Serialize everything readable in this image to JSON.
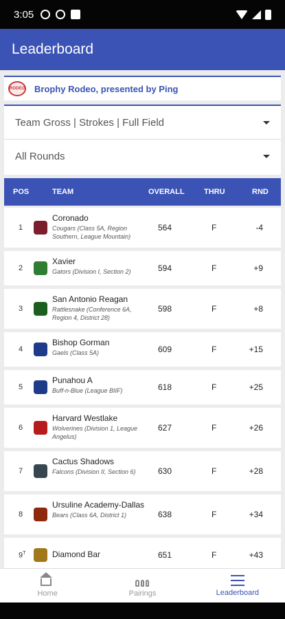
{
  "status": {
    "time": "3:05"
  },
  "appbar": {
    "title": "Leaderboard"
  },
  "tournament": {
    "name": "Brophy Rodeo, presented by Ping",
    "logo_text": "RODEO"
  },
  "filters": {
    "view": "Team Gross | Strokes | Full Field",
    "rounds": "All Rounds"
  },
  "table": {
    "headers": {
      "pos": "POS",
      "team": "TEAM",
      "overall": "OVERALL",
      "thru": "THRU",
      "rnd": "RND"
    },
    "rows": [
      {
        "pos": "1",
        "name": "Coronado",
        "sub": "Cougars (Class 5A, Region Southern, League Mountain)",
        "overall": "564",
        "thru": "F",
        "rnd": "-4",
        "color": "#7a1f2b"
      },
      {
        "pos": "2",
        "name": "Xavier",
        "sub": "Gators (Division I, Section 2)",
        "overall": "594",
        "thru": "F",
        "rnd": "+9",
        "color": "#2e7d32"
      },
      {
        "pos": "3",
        "name": "San Antonio Reagan",
        "sub": "Rattlesnake (Conference 6A, Region 4, District 28)",
        "overall": "598",
        "thru": "F",
        "rnd": "+8",
        "color": "#1b5e20"
      },
      {
        "pos": "4",
        "name": "Bishop Gorman",
        "sub": "Gaels (Class 5A)",
        "overall": "609",
        "thru": "F",
        "rnd": "+15",
        "color": "#1e3a8a"
      },
      {
        "pos": "5",
        "name": "Punahou A",
        "sub": "Buff-n-Blue (League BIIF)",
        "overall": "618",
        "thru": "F",
        "rnd": "+25",
        "color": "#1f3c88"
      },
      {
        "pos": "6",
        "name": "Harvard Westlake",
        "sub": "Wolverines (Division 1, League Angelus)",
        "overall": "627",
        "thru": "F",
        "rnd": "+26",
        "color": "#b71c1c"
      },
      {
        "pos": "7",
        "name": "Cactus Shadows",
        "sub": "Falcons (Division II, Section 6)",
        "overall": "630",
        "thru": "F",
        "rnd": "+28",
        "color": "#37474f"
      },
      {
        "pos": "8",
        "name": "Ursuline Academy-Dallas",
        "sub": "Bears (Class 6A, District 1)",
        "overall": "638",
        "thru": "F",
        "rnd": "+34",
        "color": "#8d2a0e"
      },
      {
        "pos": "9",
        "pos_note": "T",
        "name": "Diamond Bar",
        "sub": "",
        "overall": "651",
        "thru": "F",
        "rnd": "+43",
        "color": "#a0781a"
      }
    ]
  },
  "nav": {
    "home": "Home",
    "pairings": "Pairings",
    "leaderboard": "Leaderboard"
  }
}
